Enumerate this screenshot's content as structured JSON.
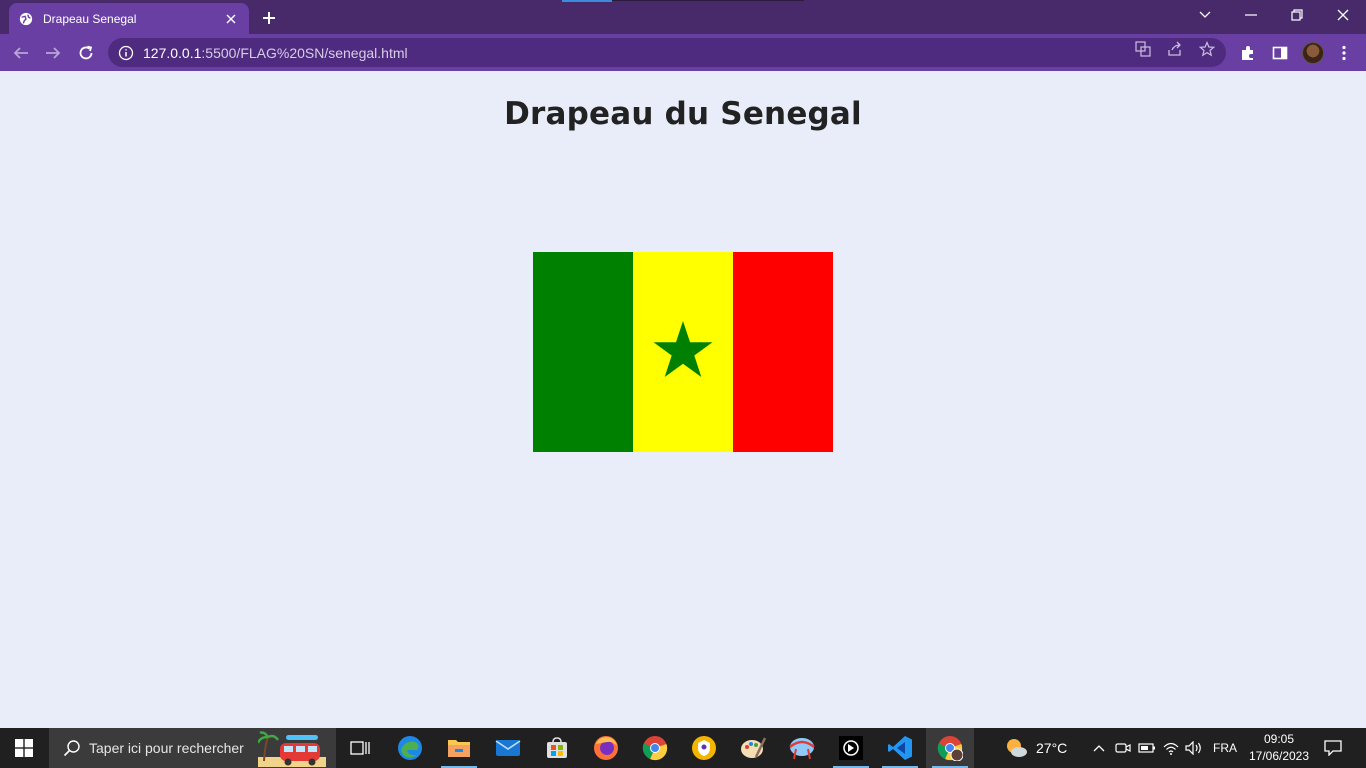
{
  "browser": {
    "tab_title": "Drapeau Senegal",
    "url_host": "127.0.0.1",
    "url_rest": ":5500/FLAG%20SN/senegal.html"
  },
  "page": {
    "heading": "Drapeau du Senegal",
    "flag": {
      "bands": [
        "#008000",
        "#ffff00",
        "#ff0000"
      ],
      "star_color": "#008000"
    }
  },
  "taskbar": {
    "search_placeholder": "Taper ici pour rechercher",
    "apps": [
      "task-view",
      "edge",
      "file-explorer",
      "mail",
      "microsoft-store",
      "firefox",
      "chrome",
      "brave",
      "paint",
      "bridge-app",
      "obs-like-app",
      "vscode",
      "chrome-active"
    ],
    "weather_temp": "27°C",
    "language": "FRA",
    "time": "09:05",
    "date": "17/06/2023"
  },
  "colors": {
    "tab_strip": "#482a6b",
    "toolbar": "#6a3fa3",
    "page_bg": "#e8edf9"
  }
}
